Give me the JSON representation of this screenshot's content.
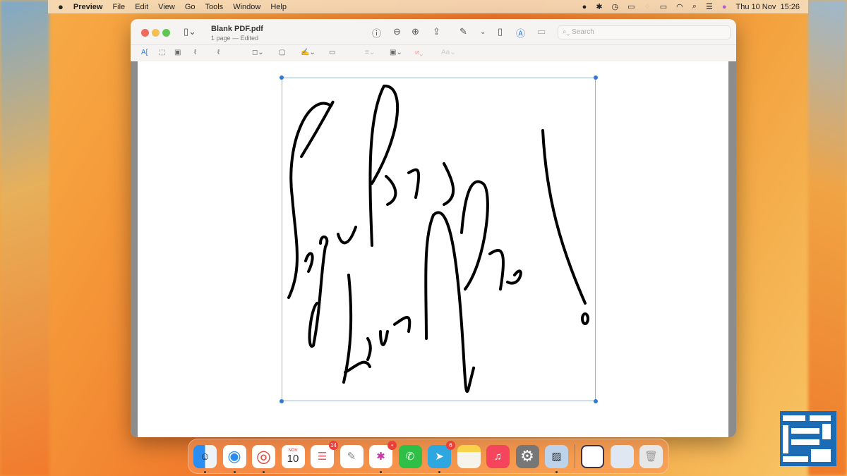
{
  "menubar": {
    "apple": "",
    "app": "Preview",
    "items": [
      "File",
      "Edit",
      "View",
      "Go",
      "Tools",
      "Window",
      "Help"
    ],
    "datetime": "Thu 10 Nov  15:26"
  },
  "window": {
    "title": "Blank PDF.pdf",
    "subtitle": "1 page — Edited",
    "search_placeholder": "Search"
  },
  "markup_toolbar": {
    "text_style_label": "Aa"
  },
  "dock": {
    "calendar_month": "NOV",
    "calendar_day": "10",
    "reminders_badge": "14",
    "slack_badge": "•",
    "telegram_badge": "6"
  },
  "colors": {
    "accent": "#2f7ad8",
    "close": "#ed6a5e",
    "minimize": "#f5bf4f",
    "zoom": "#61c554"
  }
}
